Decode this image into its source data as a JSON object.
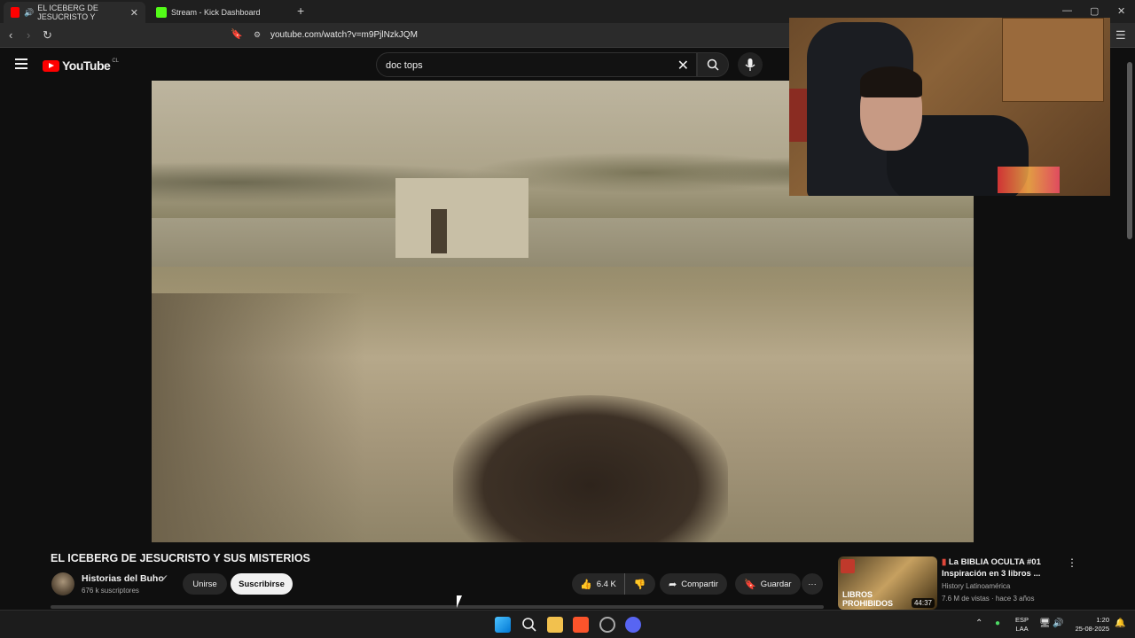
{
  "browser": {
    "tabs": [
      {
        "title": "EL ICEBERG DE JESUCRISTO Y",
        "active": true
      },
      {
        "title": "Stream - Kick Dashboard",
        "active": false
      }
    ],
    "new_tab": "+",
    "url": "youtube.com/watch?v=m9PjlNzkJQM"
  },
  "youtube": {
    "logo_text": "YouTube",
    "country_code": "CL",
    "search": {
      "value": "doc tops"
    }
  },
  "video": {
    "title": "EL ICEBERG DE JESUCRISTO Y SUS MISTERIOS",
    "channel": "Historias del Buho",
    "subscribers": "676 k suscriptores",
    "join_label": "Unirse",
    "subscribe_label": "Suscribirse",
    "likes": "6.4 K",
    "share_label": "Compartir",
    "save_label": "Guardar"
  },
  "recommended": {
    "title": "La BIBLIA OCULTA #01 Inspiración en 3 libros ...",
    "channel": "History Latinoamérica",
    "meta": "7.6 M de vistas · hace 3 años",
    "thumb_label": "LIBROS PROHIBIDOS",
    "duration": "44:37"
  },
  "taskbar": {
    "lang_line1": "ESP",
    "lang_line2": "LAA",
    "time": "1:20",
    "date": "25-08-2025"
  },
  "colors": {
    "youtube_red": "#ff0000",
    "background": "#0f0f0f"
  }
}
